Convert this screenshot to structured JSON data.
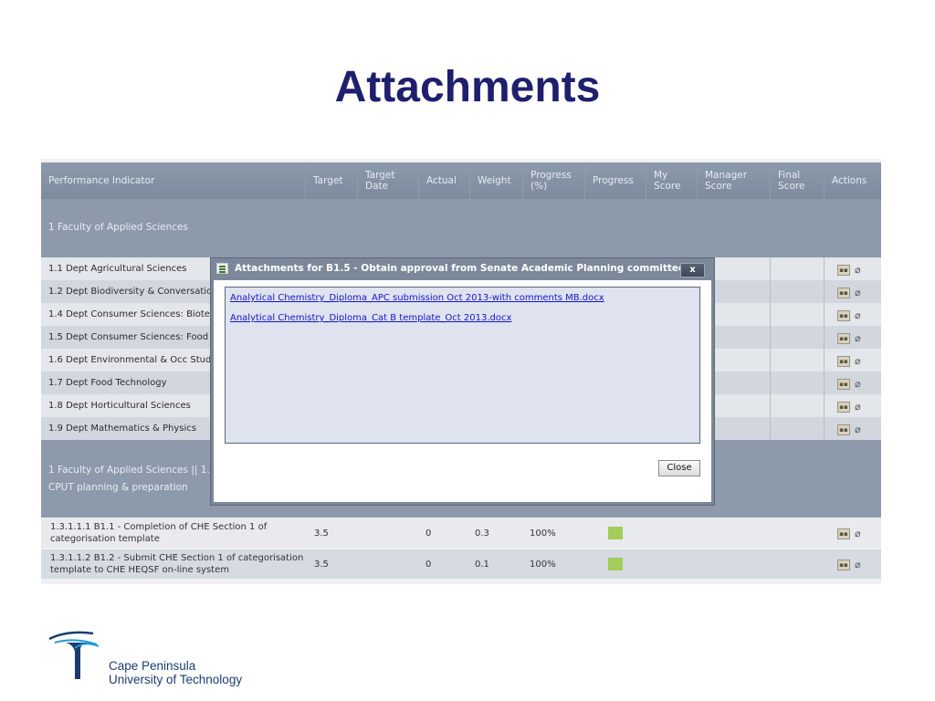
{
  "slide": {
    "title": "Attachments"
  },
  "table": {
    "headers": {
      "performance_indicator": "Performance Indicator",
      "target": "Target",
      "target_date": "Target Date",
      "actual": "Actual",
      "weight": "Weight",
      "progress_pct": "Progress (%)",
      "progress": "Progress",
      "my_score": "My Score",
      "manager_score": "Manager Score",
      "final_score": "Final Score",
      "actions": "Actions"
    },
    "group1": "1 Faculty of Applied Sciences",
    "rows": [
      {
        "label": "1.1 Dept Agricultural Sciences"
      },
      {
        "label": "1.2 Dept Biodiversity & Conversation"
      },
      {
        "label": "1.4 Dept Consumer Sciences: Biotech"
      },
      {
        "label": "1.5 Dept Consumer Sciences: Food &"
      },
      {
        "label": "1.6 Dept Environmental & Occ Studi"
      },
      {
        "label": "1.7 Dept Food Technology"
      },
      {
        "label": "1.8 Dept Horticultural Sciences"
      },
      {
        "label": "1.9 Dept Mathematics & Physics"
      }
    ],
    "group2": {
      "line1": "1 Faculty of Applied Sciences || 1.",
      "line2": "CPUT planning & preparation"
    },
    "detail_rows": [
      {
        "label": "1.3.1.1.1 B1.1 - Completion of CHE Section 1 of categorisation template",
        "target": "3.5",
        "actual": "0",
        "weight": "0.3",
        "progress_pct": "100%"
      },
      {
        "label": "1.3.1.1.2 B1.2 - Submit CHE Section 1 of categorisation template to CHE HEQSF on-line system",
        "target": "3.5",
        "actual": "0",
        "weight": "0.1",
        "progress_pct": "100%"
      }
    ],
    "progress_color": "#a3cc5a"
  },
  "dialog": {
    "title": "Attachments for B1.5 - Obtain approval from Senate Academic Planning committee",
    "close_x": "x",
    "files": [
      "Analytical Chemistry_Diploma_APC submission Oct 2013-with comments MB.docx",
      "Analytical Chemistry_Diploma_Cat B template_Oct 2013.docx"
    ],
    "close_button": "Close"
  },
  "logo": {
    "line1": "Cape Peninsula",
    "line2": "University of Technology"
  },
  "icons": {
    "row_actions": [
      "users-icon",
      "paperclip-icon"
    ],
    "dialog": "list-icon"
  }
}
